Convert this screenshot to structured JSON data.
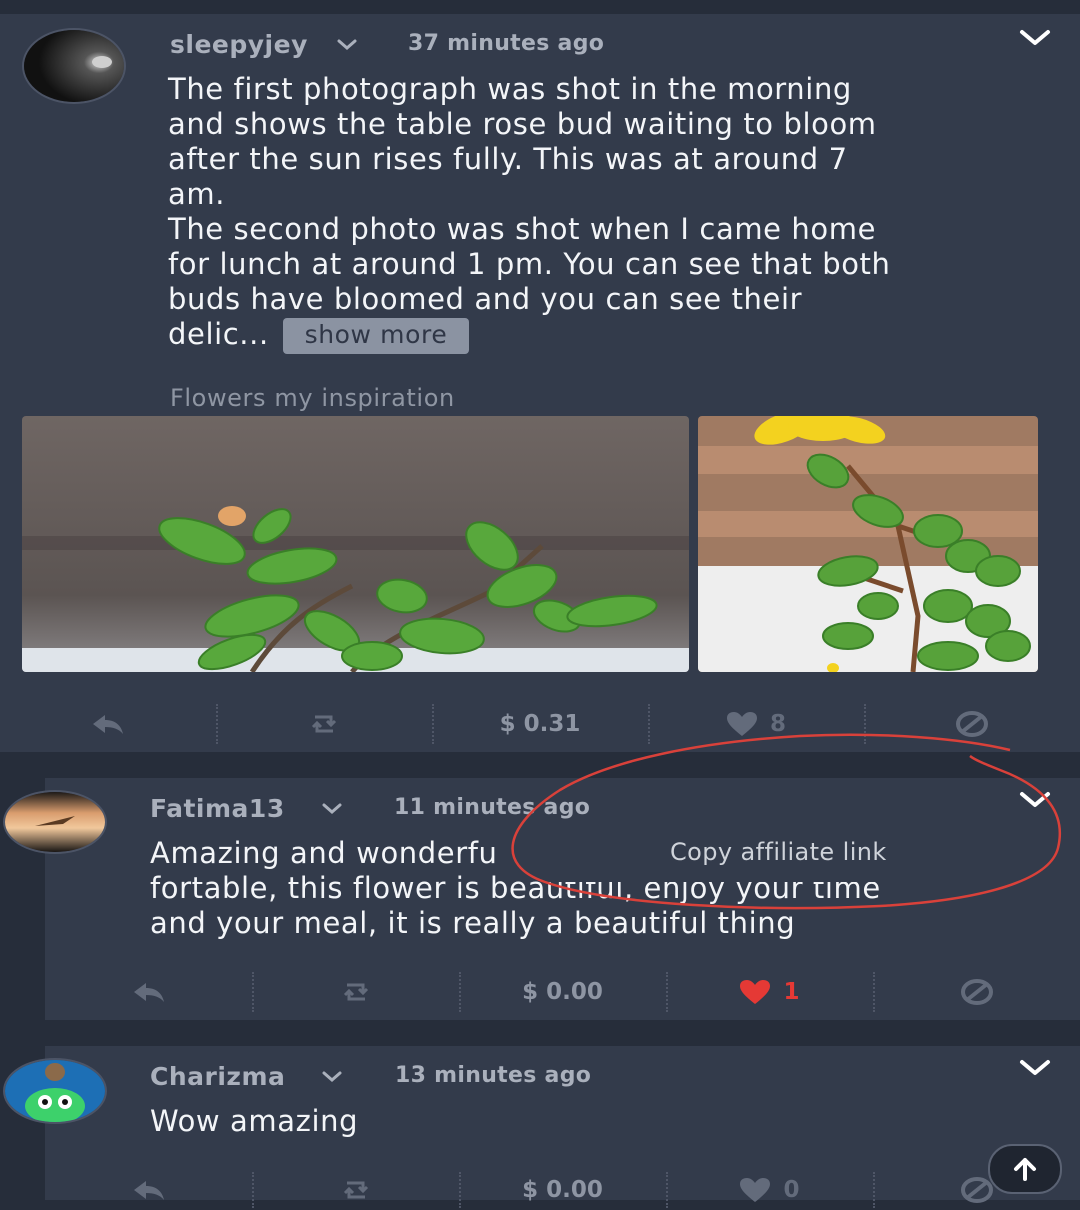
{
  "post": {
    "username": "sleepyjey",
    "timestamp": "37 minutes ago",
    "body_lines": [
      "The first photograph was shot in the morning",
      "and shows the table rose bud waiting to bloom",
      "after the sun rises fully. This was at around 7",
      "am.",
      "The second photo was shot when I came home",
      "for lunch at around 1 pm. You can see that both",
      "buds have bloomed and you can see their"
    ],
    "body_last": "delic...",
    "show_more_label": "show more",
    "tag": "Flowers my inspiration",
    "actions": {
      "payout": "$ 0.31",
      "likes": "8"
    }
  },
  "comments": [
    {
      "username": "Fatima13",
      "timestamp": "11 minutes ago",
      "body_lines": [
        "Amazing and wonderfu",
        "fortable, this flower is beautiful, enjoy your time",
        "and your meal, it is really a beautiful thing"
      ],
      "actions": {
        "payout": "$ 0.00",
        "likes": "1"
      }
    },
    {
      "username": "Charizma",
      "timestamp": "13 minutes ago",
      "body_lines": [
        "Wow amazing"
      ],
      "actions": {
        "payout": "$ 0.00",
        "likes": "0"
      }
    }
  ],
  "menu": {
    "copy_affiliate_link": "Copy affiliate link"
  },
  "colors": {
    "liked": "#e53935",
    "annotation": "#d9413a",
    "card": "#333b4b",
    "page": "#262d3a"
  },
  "icons": [
    "reply-icon",
    "resteem-icon",
    "heart-icon",
    "flag-icon",
    "chevron-down-icon",
    "arrow-up-icon"
  ]
}
